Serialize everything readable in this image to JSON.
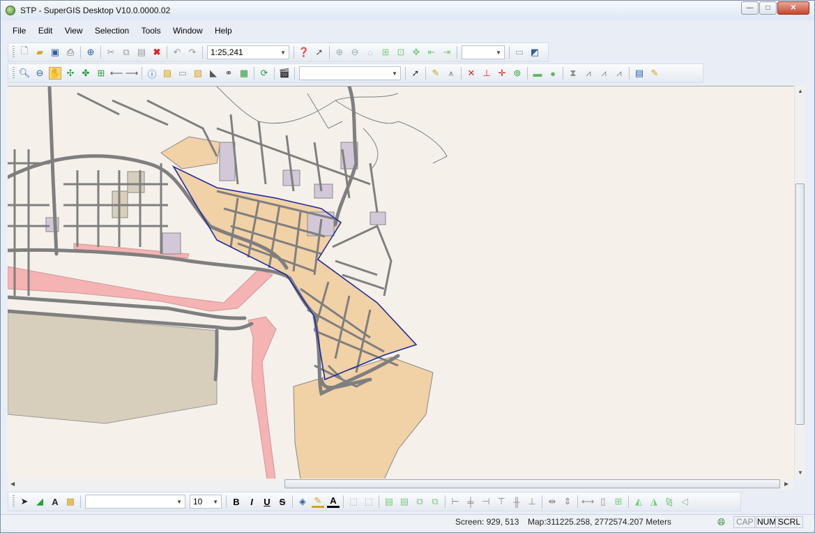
{
  "window": {
    "title": "STP - SuperGIS Desktop V10.0.0000.02",
    "controls": {
      "minimize": "—",
      "maximize": "□",
      "close": "✕"
    }
  },
  "menu": [
    "File",
    "Edit",
    "View",
    "Selection",
    "Tools",
    "Window",
    "Help"
  ],
  "toolbar_standard": {
    "scale_value": "1:25,241",
    "icons": [
      "new-icon",
      "open-icon",
      "save-icon",
      "print-icon",
      "add-data-icon",
      "cut-icon",
      "copy-icon",
      "paste-icon",
      "delete-icon",
      "undo-icon",
      "redo-icon"
    ],
    "help_icons": [
      "help-icon",
      "whats-this-icon"
    ],
    "layout_icons": [
      "layout-zoom-in-icon",
      "layout-zoom-out-icon",
      "layout-zoom-100-icon",
      "layout-full-extent-icon",
      "layout-zoom-page-icon",
      "layout-pan-icon",
      "layout-back-icon",
      "layout-forward-icon"
    ],
    "layout_zoom_value": "",
    "extra_icons": [
      "page-setup-icon",
      "layout-view-icon"
    ]
  },
  "toolbar_tools": {
    "icons": [
      "zoom-in-icon",
      "zoom-out-icon",
      "pan-icon",
      "full-extent-icon",
      "fixed-zoom-icon",
      "zoom-to-layer-icon",
      "back-extent-icon",
      "forward-extent-icon",
      "identify-icon",
      "select-feature-icon",
      "clear-selection-icon",
      "select-by-graphic-icon",
      "measure-icon",
      "hyperlink-icon",
      "attribute-table-icon",
      "refresh-icon",
      "animation-icon"
    ],
    "layer_dropdown_value": "",
    "edit_icons": [
      "edit-tool-icon",
      "sketch-icon",
      "sketch-dropdown-icon",
      "split-icon",
      "reshape-icon",
      "move-vertex-icon",
      "rotate-icon",
      "rectangle-icon",
      "circle-icon",
      "mirror-icon",
      "extend-icon",
      "trim-icon",
      "stretch-icon",
      "attributes-icon",
      "edit-pen-icon"
    ]
  },
  "toolbar_draw": {
    "icons": [
      "select-elements-icon",
      "draw-shape-icon",
      "text-icon",
      "new-graphics-icon"
    ],
    "font_name_value": "",
    "font_size_value": "10",
    "style_buttons": [
      "B",
      "I",
      "U",
      "S"
    ],
    "color_icons": [
      "fill-color-icon",
      "line-color-icon",
      "font-color-icon"
    ],
    "arrange_icons": [
      "group-icon",
      "ungroup-icon",
      "bring-to-front-icon",
      "send-to-back-icon",
      "bring-forward-icon",
      "send-backward-icon",
      "align-left-icon",
      "align-center-icon",
      "align-right-icon",
      "align-top-icon",
      "align-middle-icon",
      "align-bottom-icon",
      "distribute-horizontally-icon",
      "distribute-vertically-icon",
      "same-width-icon",
      "same-height-icon",
      "same-size-icon",
      "rotate-left-icon",
      "rotate-right-icon",
      "flip-horizontal-icon",
      "flip-vertical-icon"
    ]
  },
  "status": {
    "screen": "Screen: 929, 513",
    "map": "Map:311225.258, 2772574.207 Meters",
    "cap": "CAP",
    "num": "NUM",
    "scrl": "SCRL"
  },
  "map_colors": {
    "background": "#f5f1ea",
    "roads": "#7f7f7f",
    "zone_orange": "#f1d1a6",
    "zone_pink": "#f6b3b3",
    "zone_purple": "#d3c8d8",
    "zone_tan": "#d8cebc",
    "selection_outline": "#1f2a9e",
    "rivers": "#7e7e7e"
  }
}
